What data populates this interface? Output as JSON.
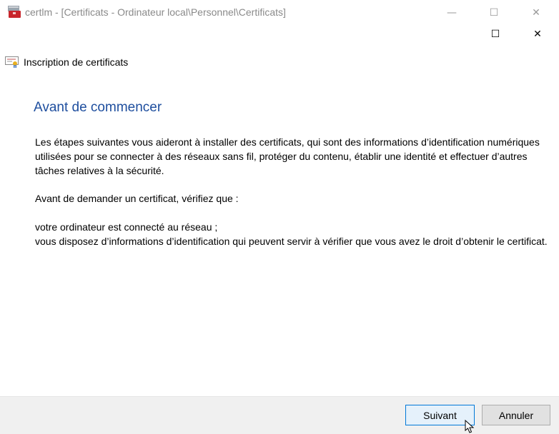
{
  "window": {
    "title": "certlm - [Certificats - Ordinateur local\\Personnel\\Certificats]"
  },
  "dialog": {
    "title": "Inscription de certificats"
  },
  "content": {
    "heading": "Avant de commencer",
    "para1": "Les étapes suivantes vous aideront à installer des certificats, qui sont des informations d’identification numériques utilisées pour se connecter à des réseaux sans fil, protéger du contenu, établir une identité et effectuer d’autres tâches relatives à la sécurité.",
    "para2": "Avant de demander un certificat, vérifiez que :",
    "item1": "votre ordinateur est connecté au réseau ;",
    "item2": "vous disposez d’informations d’identification qui peuvent servir à vérifier que vous avez le droit d’obtenir le certificat."
  },
  "buttons": {
    "next": "Suivant",
    "cancel": "Annuler"
  },
  "controls": {
    "minimize": "—",
    "maximize": "☐",
    "close": "✕"
  }
}
